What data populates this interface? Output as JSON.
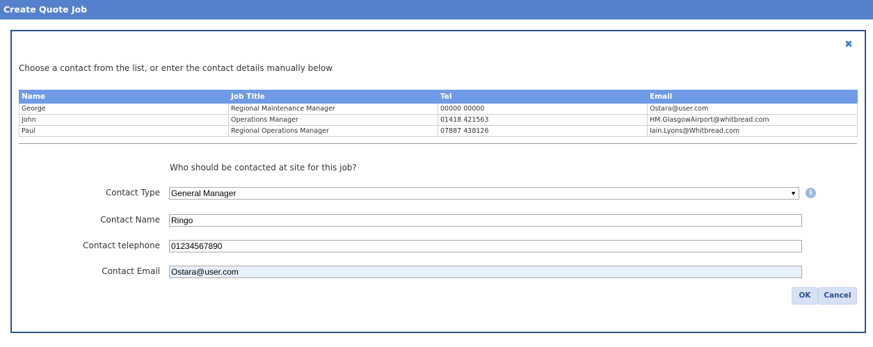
{
  "window": {
    "title": "Create Quote Job"
  },
  "dialog": {
    "close_icon": "close-icon",
    "instructions": "Choose a contact from the list, or enter the contact details manually below",
    "table": {
      "headers": [
        "Name",
        "Job Title",
        "Tel",
        "Email"
      ],
      "rows": [
        [
          "George",
          "Regional Maintenance Manager",
          "00000 00000",
          "Ostara@user.com"
        ],
        [
          "John",
          "Operations Manager",
          "01418 421563",
          "HM.GlasgowAirport@whitbread.com"
        ],
        [
          "Paul",
          "Regional Operations Manager",
          "07887 438126",
          "Iain.Lyons@Whitbread.com"
        ]
      ]
    },
    "question": "Who should be contacted at site for this job?",
    "form": {
      "contact_type_label": "Contact Type",
      "contact_type_value": "General Manager",
      "contact_name_label": "Contact Name",
      "contact_name_value": "Ringo",
      "contact_tel_label": "Contact telephone",
      "contact_tel_value": "01234567890",
      "contact_email_label": "Contact Email",
      "contact_email_value": "Ostara@user.com"
    },
    "buttons": {
      "ok": "OK",
      "cancel": "Cancel"
    }
  },
  "colors": {
    "titlebar": "#5580cc",
    "table_header": "#6f9be6",
    "dialog_border": "#2c4f8c",
    "button_bg": "#d6e1f5"
  }
}
